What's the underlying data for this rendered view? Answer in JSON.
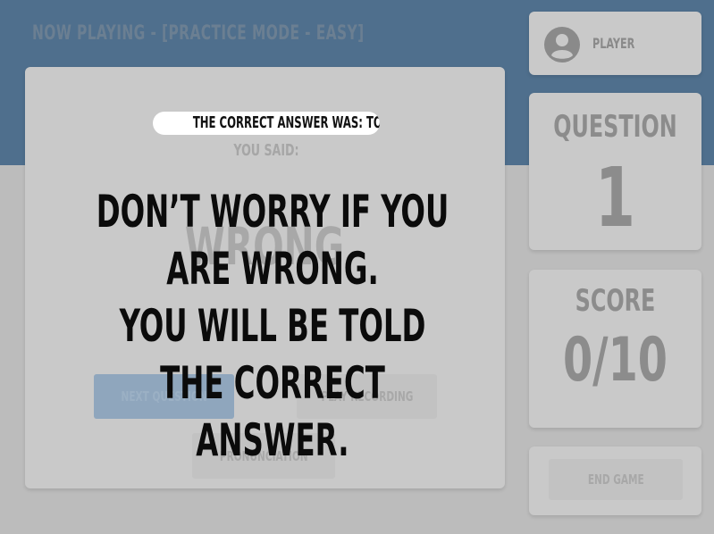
{
  "header": {
    "title": "NOW PLAYING - [PRACTICE MODE - EASY]"
  },
  "player": {
    "label": "PLAYER",
    "icon": "user-avatar-icon"
  },
  "question": {
    "heading": "QUESTION",
    "number": "1"
  },
  "score": {
    "heading": "SCORE",
    "value": "0/10"
  },
  "main": {
    "correct_answer": "THE CORRECT ANSWER WAS: TORU",
    "you_said": "YOU SAID:",
    "verdict": "WRONG",
    "buttons": {
      "next_question": "NEXT QUESTION",
      "play_recording": "PLAY RECORDING",
      "pronunciation": "PRONUNCIATION"
    }
  },
  "end_game": {
    "label": "END GAME"
  },
  "tutorial": {
    "line1": "DON’T WORRY IF YOU ARE WRONG.",
    "line2": "YOU WILL BE TOLD THE CORRECT",
    "line3": "ANSWER."
  },
  "colors": {
    "header_band": "#4f6f8d",
    "background": "#bcbcbc",
    "card": "#c9c9c9",
    "primary_button": "#8fa6bd",
    "tip_text": "#0b0b0b",
    "pill_background": "#ffffff"
  }
}
